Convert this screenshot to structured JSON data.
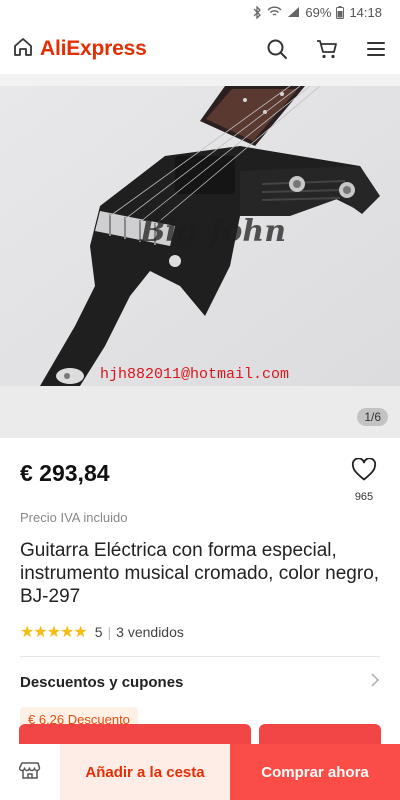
{
  "status_bar": {
    "battery": "69%",
    "time": "14:18"
  },
  "header": {
    "logo_text": "AliExpress",
    "icons": [
      "home-icon",
      "search-icon",
      "cart-icon",
      "menu-icon"
    ]
  },
  "gallery": {
    "watermark_brand": "Big John",
    "watermark_email": "hjh882011@hotmail.com",
    "counter": "1/6"
  },
  "product": {
    "price": "€ 293,84",
    "wishlist_count": "965",
    "vat_note": "Precio IVA incluido",
    "title": "Guitarra Eléctrica con forma especial, instrumento musical cromado, color negro, BJ-297",
    "stars": "★★★★★",
    "rating": "5",
    "sold": "3 vendidos"
  },
  "coupons": {
    "title": "Descuentos y cupones",
    "discount_tag": "€ 6,26 Descuento"
  },
  "bottom_bar": {
    "add_to_cart": "Añadir a la cesta",
    "buy_now": "Comprar ahora"
  },
  "colors": {
    "brand": "#e62e04",
    "buy": "#fb4d47",
    "cart_bg": "#feece6",
    "star": "#f5bd13"
  }
}
